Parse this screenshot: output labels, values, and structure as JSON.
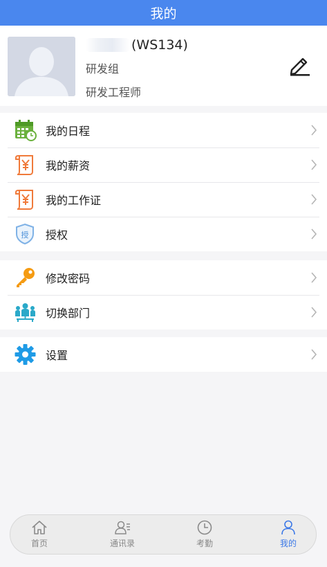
{
  "header": {
    "title": "我的"
  },
  "profile": {
    "name_suffix": "(WS134)",
    "department": "研发组",
    "job_title": "研发工程师"
  },
  "menu_groups": [
    [
      {
        "label": "我的日程",
        "icon": "calendar-icon"
      },
      {
        "label": "我的薪资",
        "icon": "salary-receipt-icon"
      },
      {
        "label": "我的工作证",
        "icon": "work-badge-icon"
      },
      {
        "label": "授权",
        "icon": "authorize-shield-icon"
      }
    ],
    [
      {
        "label": "修改密码",
        "icon": "key-icon"
      },
      {
        "label": "切换部门",
        "icon": "team-switch-icon"
      }
    ],
    [
      {
        "label": "设置",
        "icon": "gear-icon"
      }
    ]
  ],
  "tabbar": {
    "items": [
      {
        "label": "首页",
        "icon": "home-icon"
      },
      {
        "label": "通讯录",
        "icon": "contacts-icon"
      },
      {
        "label": "考勤",
        "icon": "clock-icon"
      },
      {
        "label": "我的",
        "icon": "profile-icon"
      }
    ],
    "active": "我的"
  },
  "colors": {
    "header": "#4a87ee",
    "tab_active": "#3b78e7",
    "salary_icon": "#f07a3a",
    "calendar_icon": "#6bb13d",
    "key_icon": "#f59b12",
    "gear_icon": "#1f9be6"
  }
}
